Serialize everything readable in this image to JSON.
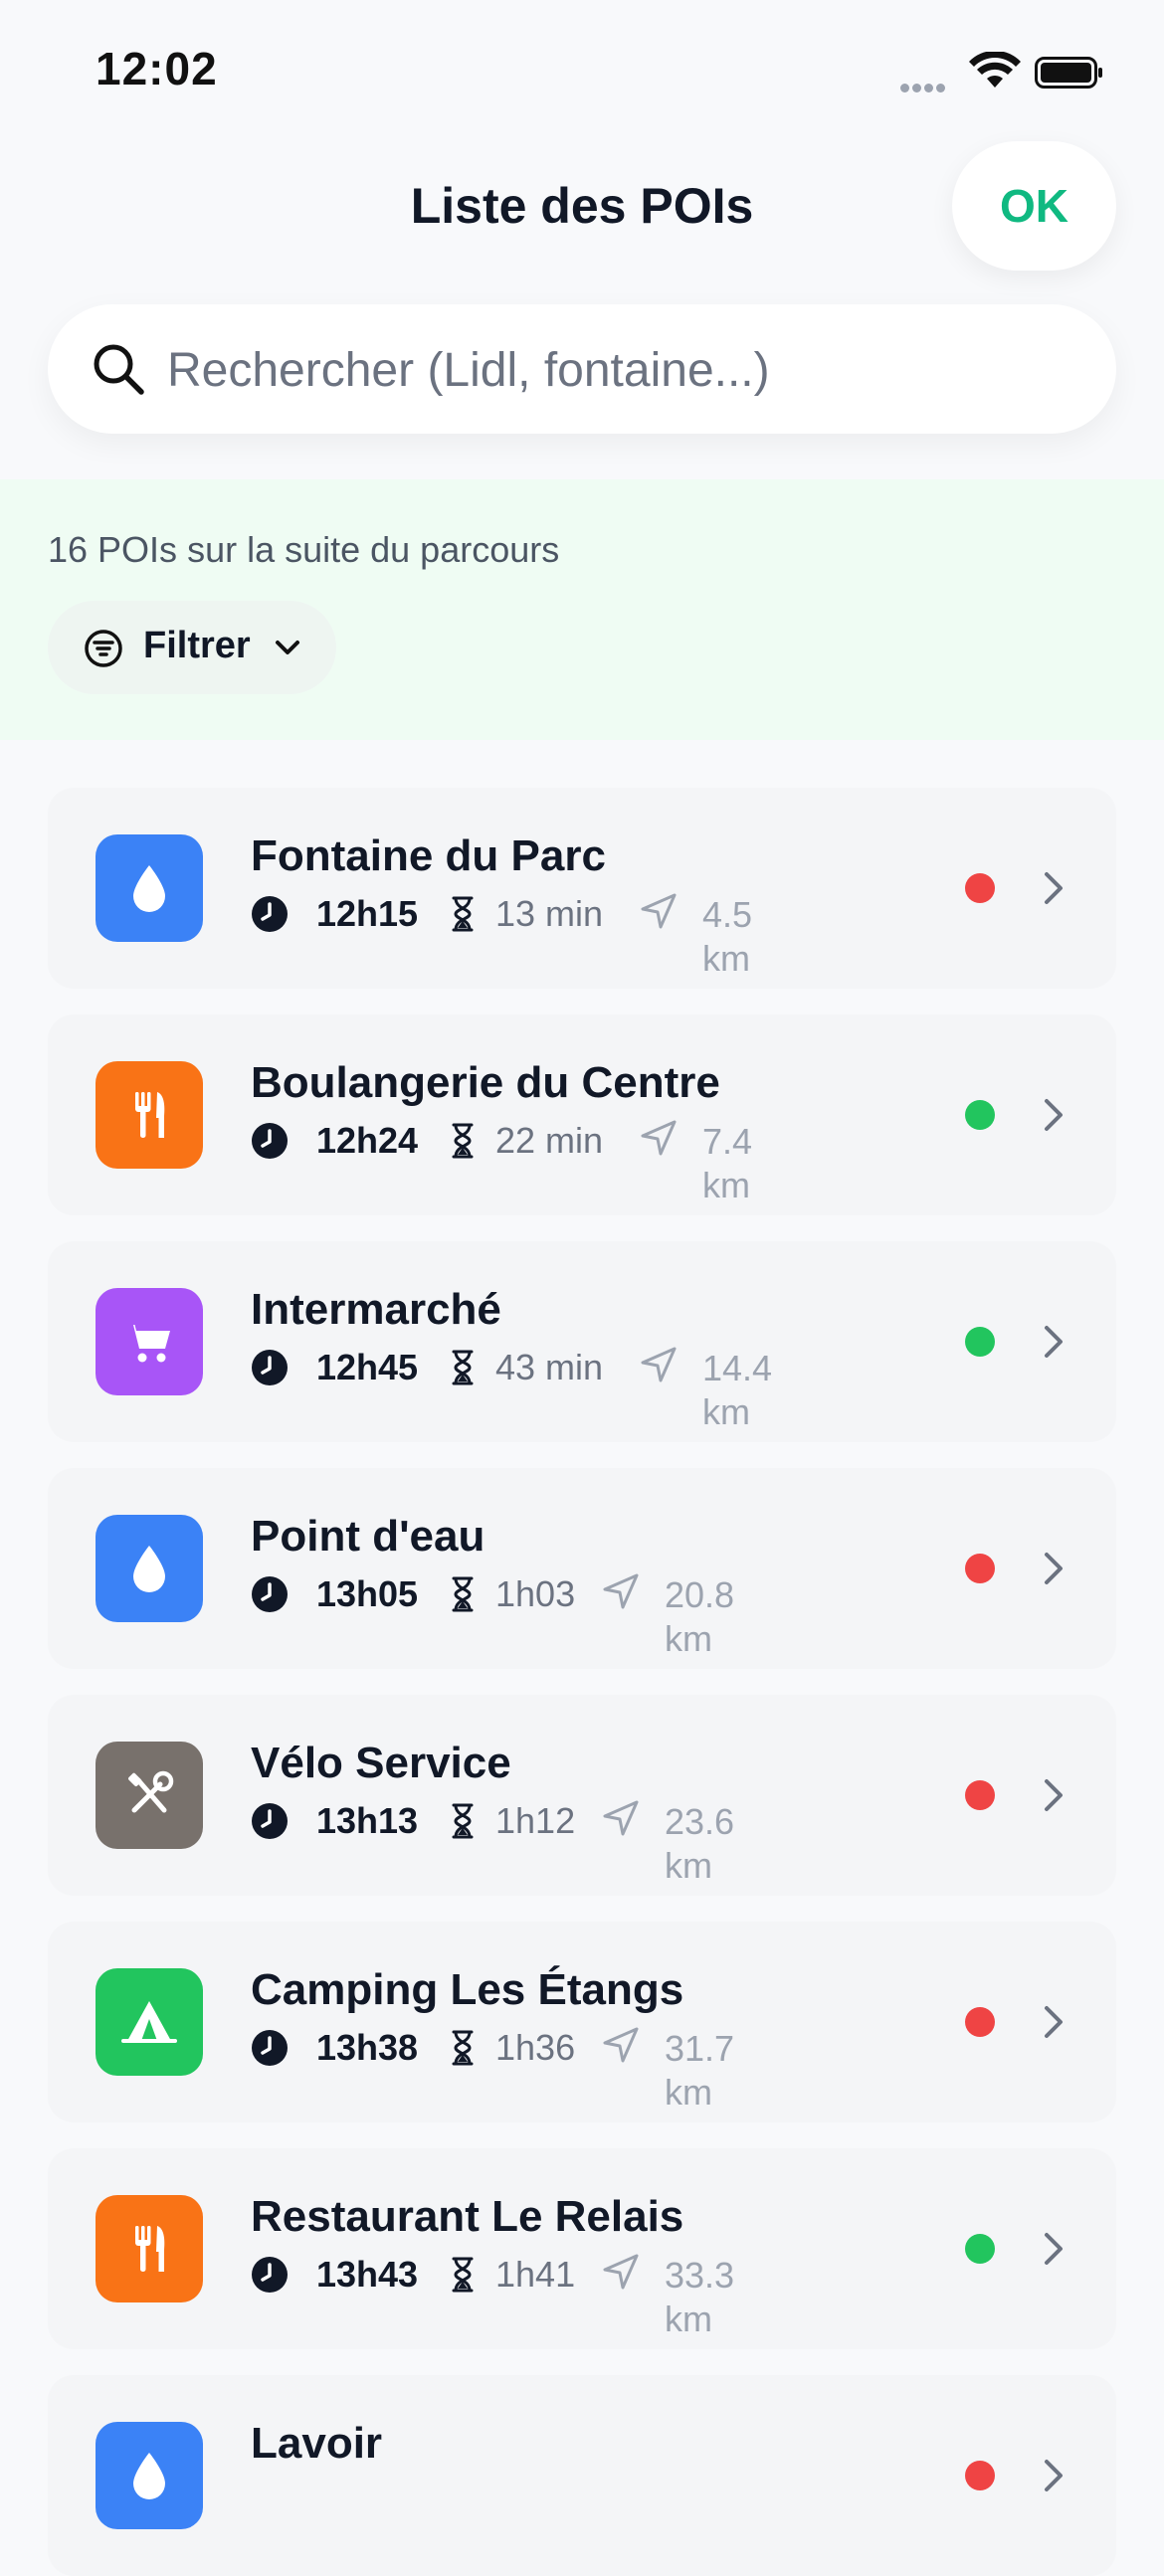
{
  "status_bar": {
    "time": "12:02"
  },
  "header": {
    "title": "Liste des POIs",
    "ok_label": "OK"
  },
  "search": {
    "placeholder": "Rechercher (Lidl, fontaine...)",
    "value": ""
  },
  "summary": {
    "count_text": "16 POIs sur la suite du parcours",
    "filter_label": "Filtrer"
  },
  "colors": {
    "accent": "#10b981",
    "status_red": "#ef4444",
    "status_green": "#22c55e",
    "water": "#3b82f6",
    "food": "#f97316",
    "shop": "#a855f7",
    "repair": "#78716c",
    "camping": "#22c55e"
  },
  "pois": [
    {
      "name": "Fontaine du Parc",
      "time": "12h15",
      "duration": "13 min",
      "distance": "4.5 km",
      "category_icon": "water-drop-icon",
      "category_color": "#3b82f6",
      "status": "red"
    },
    {
      "name": "Boulangerie du Centre",
      "time": "12h24",
      "duration": "22 min",
      "distance": "7.4 km",
      "category_icon": "fork-knife-icon",
      "category_color": "#f97316",
      "status": "green"
    },
    {
      "name": "Intermarché",
      "time": "12h45",
      "duration": "43 min",
      "distance": "14.4 km",
      "category_icon": "shopping-cart-icon",
      "category_color": "#a855f7",
      "status": "green"
    },
    {
      "name": "Point d'eau",
      "time": "13h05",
      "duration": "1h03",
      "distance": "20.8 km",
      "category_icon": "water-drop-icon",
      "category_color": "#3b82f6",
      "status": "red"
    },
    {
      "name": "Vélo Service",
      "time": "13h13",
      "duration": "1h12",
      "distance": "23.6 km",
      "category_icon": "tools-icon",
      "category_color": "#78716c",
      "status": "red"
    },
    {
      "name": "Camping Les Étangs",
      "time": "13h38",
      "duration": "1h36",
      "distance": "31.7 km",
      "category_icon": "tent-icon",
      "category_color": "#22c55e",
      "status": "red"
    },
    {
      "name": "Restaurant Le Relais",
      "time": "13h43",
      "duration": "1h41",
      "distance": "33.3 km",
      "category_icon": "fork-knife-icon",
      "category_color": "#f97316",
      "status": "green"
    },
    {
      "name": "Lavoir",
      "time": "",
      "duration": "",
      "distance": "",
      "category_icon": "water-drop-icon",
      "category_color": "#3b82f6",
      "status": "red"
    }
  ]
}
